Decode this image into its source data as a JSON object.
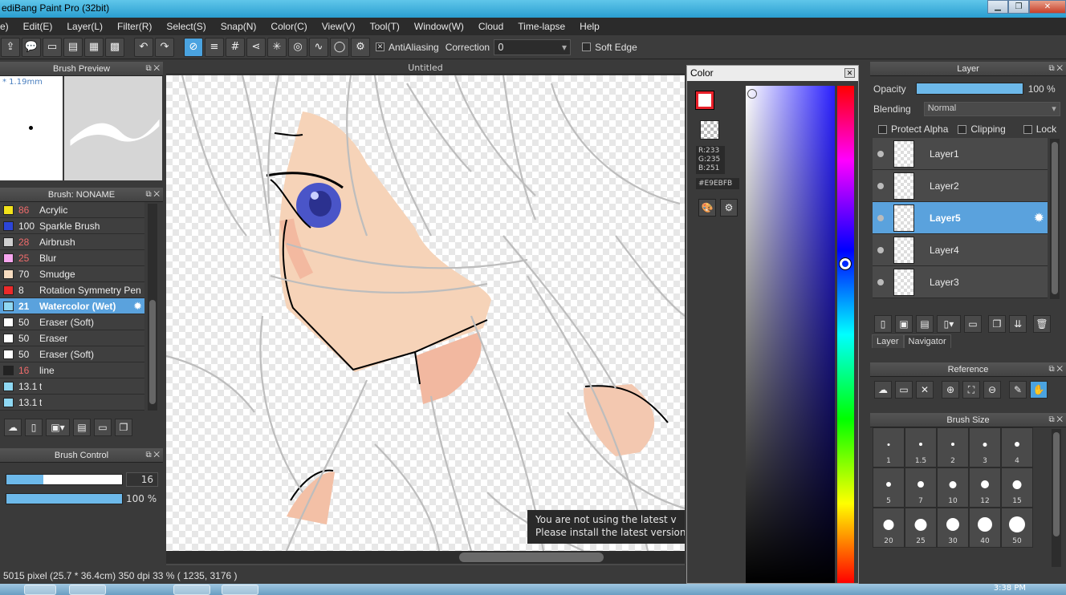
{
  "window": {
    "title": "ediBang Paint Pro (32bit)"
  },
  "menu": [
    "e)",
    "Edit(E)",
    "Layer(L)",
    "Filter(R)",
    "Select(S)",
    "Snap(N)",
    "Color(C)",
    "View(V)",
    "Tool(T)",
    "Window(W)",
    "Cloud",
    "Time-lapse",
    "Help"
  ],
  "toolbar": {
    "antialiasing_label": "AntiAliasing",
    "correction_label": "Correction",
    "correction_value": "0",
    "soft_edge_label": "Soft Edge"
  },
  "brush_preview": {
    "title": "Brush Preview",
    "size": "* 1.19mm"
  },
  "brush_panel": {
    "title": "Brush: NONAME",
    "items": [
      {
        "size": "86",
        "name": "Acrylic",
        "color": "#f2e21a",
        "red": true
      },
      {
        "size": "100",
        "name": "Sparkle Brush",
        "color": "#2c45d8",
        "red": false
      },
      {
        "size": "28",
        "name": "Airbrush",
        "color": "#cfcfcf",
        "red": true
      },
      {
        "size": "25",
        "name": "Blur",
        "color": "#f7a6ef",
        "red": true
      },
      {
        "size": "70",
        "name": "Smudge",
        "color": "#f7dcc0",
        "red": false
      },
      {
        "size": "8",
        "name": "Rotation Symmetry Pen",
        "color": "#ec2a2a",
        "red": false
      },
      {
        "size": "21",
        "name": "Watercolor (Wet)",
        "color": "#8fd8f3",
        "red": true,
        "selected": true
      },
      {
        "size": "50",
        "name": "Eraser (Soft)",
        "color": "#ffffff",
        "red": false
      },
      {
        "size": "50",
        "name": "Eraser",
        "color": "#ffffff",
        "red": false
      },
      {
        "size": "50",
        "name": "Eraser (Soft)",
        "color": "#ffffff",
        "red": false
      },
      {
        "size": "16",
        "name": "line",
        "color": "#222222",
        "red": true
      },
      {
        "size": "13.1",
        "name": "t",
        "color": "#8fd8f3",
        "red": false
      },
      {
        "size": "13.1",
        "name": "t",
        "color": "#8fd8f3",
        "red": false
      }
    ]
  },
  "brush_control": {
    "title": "Brush Control",
    "size_value": "16",
    "size_fraction": 0.32,
    "opacity_value": "100 %",
    "opacity_fraction": 1.0
  },
  "canvas": {
    "tab": "Untitled"
  },
  "notice": {
    "line1": "You are not using the latest v",
    "line2": "Please install the latest version o"
  },
  "status": {
    "text": "5015 pixel  (25.7 * 36.4cm)  350 dpi  33 %  ( 1235, 3176 )"
  },
  "color_panel": {
    "title": "Color",
    "r": "R:233",
    "g": "G:235",
    "b": "B:251",
    "hex": "#E9EBFB",
    "fg_color": "#ffffff",
    "accent": "#e8202a"
  },
  "layer_panel": {
    "title": "Layer",
    "opacity_label": "Opacity",
    "opacity_value": "100 %",
    "opacity_fraction": 1.0,
    "blending_label": "Blending",
    "blending_value": "Normal",
    "protect_alpha": "Protect Alpha",
    "clipping": "Clipping",
    "lock": "Lock",
    "layers": [
      {
        "name": "Layer1",
        "selected": false
      },
      {
        "name": "Layer2",
        "selected": false
      },
      {
        "name": "Layer5",
        "selected": true
      },
      {
        "name": "Layer4",
        "selected": false
      },
      {
        "name": "Layer3",
        "selected": false
      }
    ],
    "tab_layer": "Layer",
    "tab_navigator": "Navigator"
  },
  "reference_panel": {
    "title": "Reference"
  },
  "brush_size_panel": {
    "title": "Brush Size",
    "sizes": [
      "1",
      "1.5",
      "2",
      "3",
      "4",
      "5",
      "7",
      "10",
      "12",
      "15",
      "20",
      "25",
      "30",
      "40",
      "50"
    ]
  },
  "taskbar": {
    "clock": "3:38 PM"
  }
}
